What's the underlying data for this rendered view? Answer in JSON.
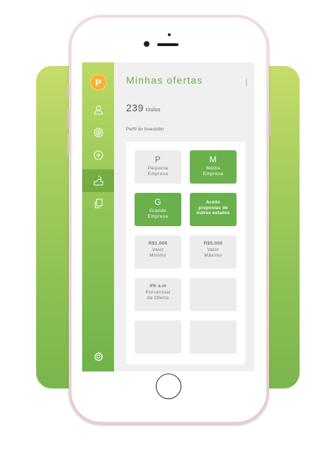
{
  "header": {
    "title": "Minhas ofertas"
  },
  "summary": {
    "count": "239",
    "unit": "títulos"
  },
  "profile": {
    "label": "Perfil do Investidor"
  },
  "brand": {
    "logo_letter": "P",
    "accent": "#6ab04c",
    "logo_color": "#f2b233"
  },
  "sidebar": {
    "items": [
      {
        "icon": "user-icon"
      },
      {
        "icon": "target-icon"
      },
      {
        "icon": "add-circle-icon"
      },
      {
        "icon": "hand-money-icon",
        "active": true
      },
      {
        "icon": "documents-icon"
      }
    ],
    "footer_icon": "settings-gear-icon"
  },
  "tiles": {
    "p": {
      "letter": "P",
      "label_1": "Pequena",
      "label_2": "Empresa",
      "selected": false
    },
    "m": {
      "letter": "M",
      "label_1": "Média",
      "label_2": "Empresa",
      "selected": true
    },
    "g": {
      "letter": "G",
      "label_1": "Grande",
      "label_2": "Empresa",
      "selected": true
    },
    "aceito": {
      "line_1": "Aceito",
      "line_2": "propostas de",
      "line_3": "outros estados",
      "selected": true
    },
    "valor_min": {
      "value": "R$1.000",
      "label_1": "Valor",
      "label_2": "Mínimo"
    },
    "valor_max": {
      "value": "R$5.000",
      "label_1": "Valor",
      "label_2": "Máximo"
    },
    "percentual": {
      "value": "4% a.m",
      "label_1": "Porcentual",
      "label_2": "da Oferta"
    }
  }
}
